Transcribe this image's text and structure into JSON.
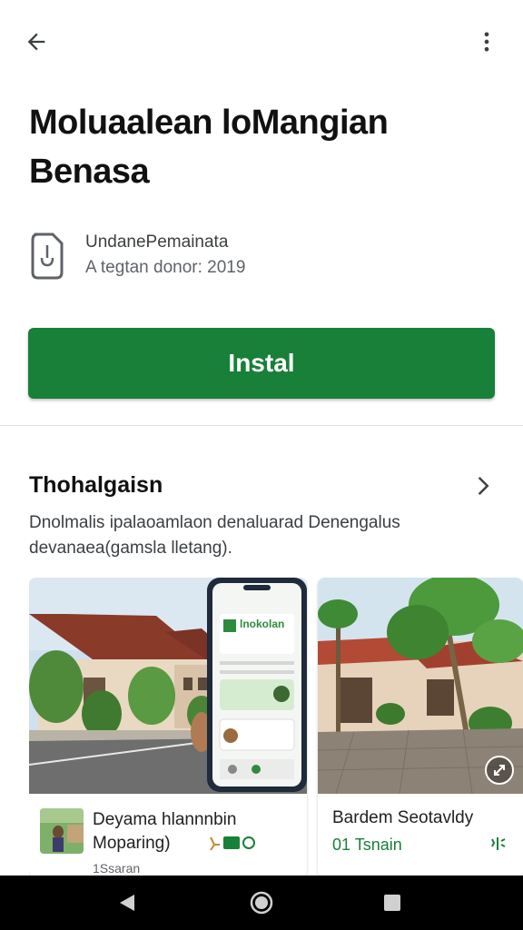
{
  "app": {
    "title": "Moluaalean loMangian Benasa",
    "developer": "UndanePemainata",
    "release_info": "A tegtan donor: 2019",
    "install_label": "Instal"
  },
  "section": {
    "title": "Thohalgaisn",
    "description": "Dnolmalis ipalaoamlaon denaluarad Denengalus devanaea(gamsla lletang)."
  },
  "screenshots": [
    {
      "phone_app_title": "lnokolan",
      "caption": "Deyama hlannnbin Moparing)",
      "sub": "1Ssaran"
    },
    {
      "caption": "Bardem Seotavldy",
      "sub": "01 Tsnain"
    }
  ],
  "icons": {
    "back": "back-arrow-icon",
    "more": "more-vert-icon",
    "developer": "document-icon",
    "section_arrow": "chevron-right-icon",
    "expand": "expand-icon",
    "nav_back": "nav-back-icon",
    "nav_home": "nav-home-icon",
    "nav_recents": "nav-recents-icon"
  },
  "colors": {
    "accent": "#188038",
    "background": "#ffffff",
    "navbar": "#000000"
  }
}
